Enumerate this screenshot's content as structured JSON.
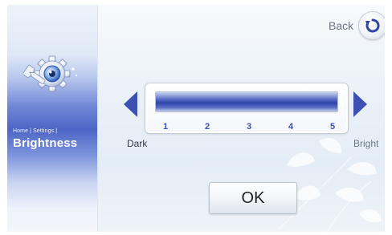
{
  "sidebar": {
    "breadcrumb": "Home | Settings |",
    "title": "Brightness"
  },
  "header": {
    "back_label": "Back"
  },
  "brightness": {
    "min_label": "Dark",
    "max_label": "Bright",
    "ticks": [
      "1",
      "2",
      "3",
      "4",
      "5"
    ],
    "level_fraction": 1.0
  },
  "actions": {
    "ok_label": "OK"
  },
  "colors": {
    "accent": "#3d51b3",
    "sidebar": "#4d66c6"
  },
  "icons": {
    "settings": "gear-wrench-icon",
    "back": "back-arrow-icon",
    "decrease": "triangle-left-icon",
    "increase": "triangle-right-icon"
  }
}
